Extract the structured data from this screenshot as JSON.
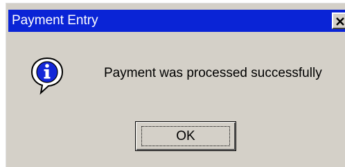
{
  "dialog": {
    "title": "Payment Entry",
    "message": "Payment was processed successfully",
    "icon": "info-icon",
    "ok_label": "OK",
    "close_icon": "close-icon"
  },
  "colors": {
    "titlebar": "#0a24d6",
    "dialog_background": "#d4d0c8",
    "title_text": "#ffffff"
  }
}
